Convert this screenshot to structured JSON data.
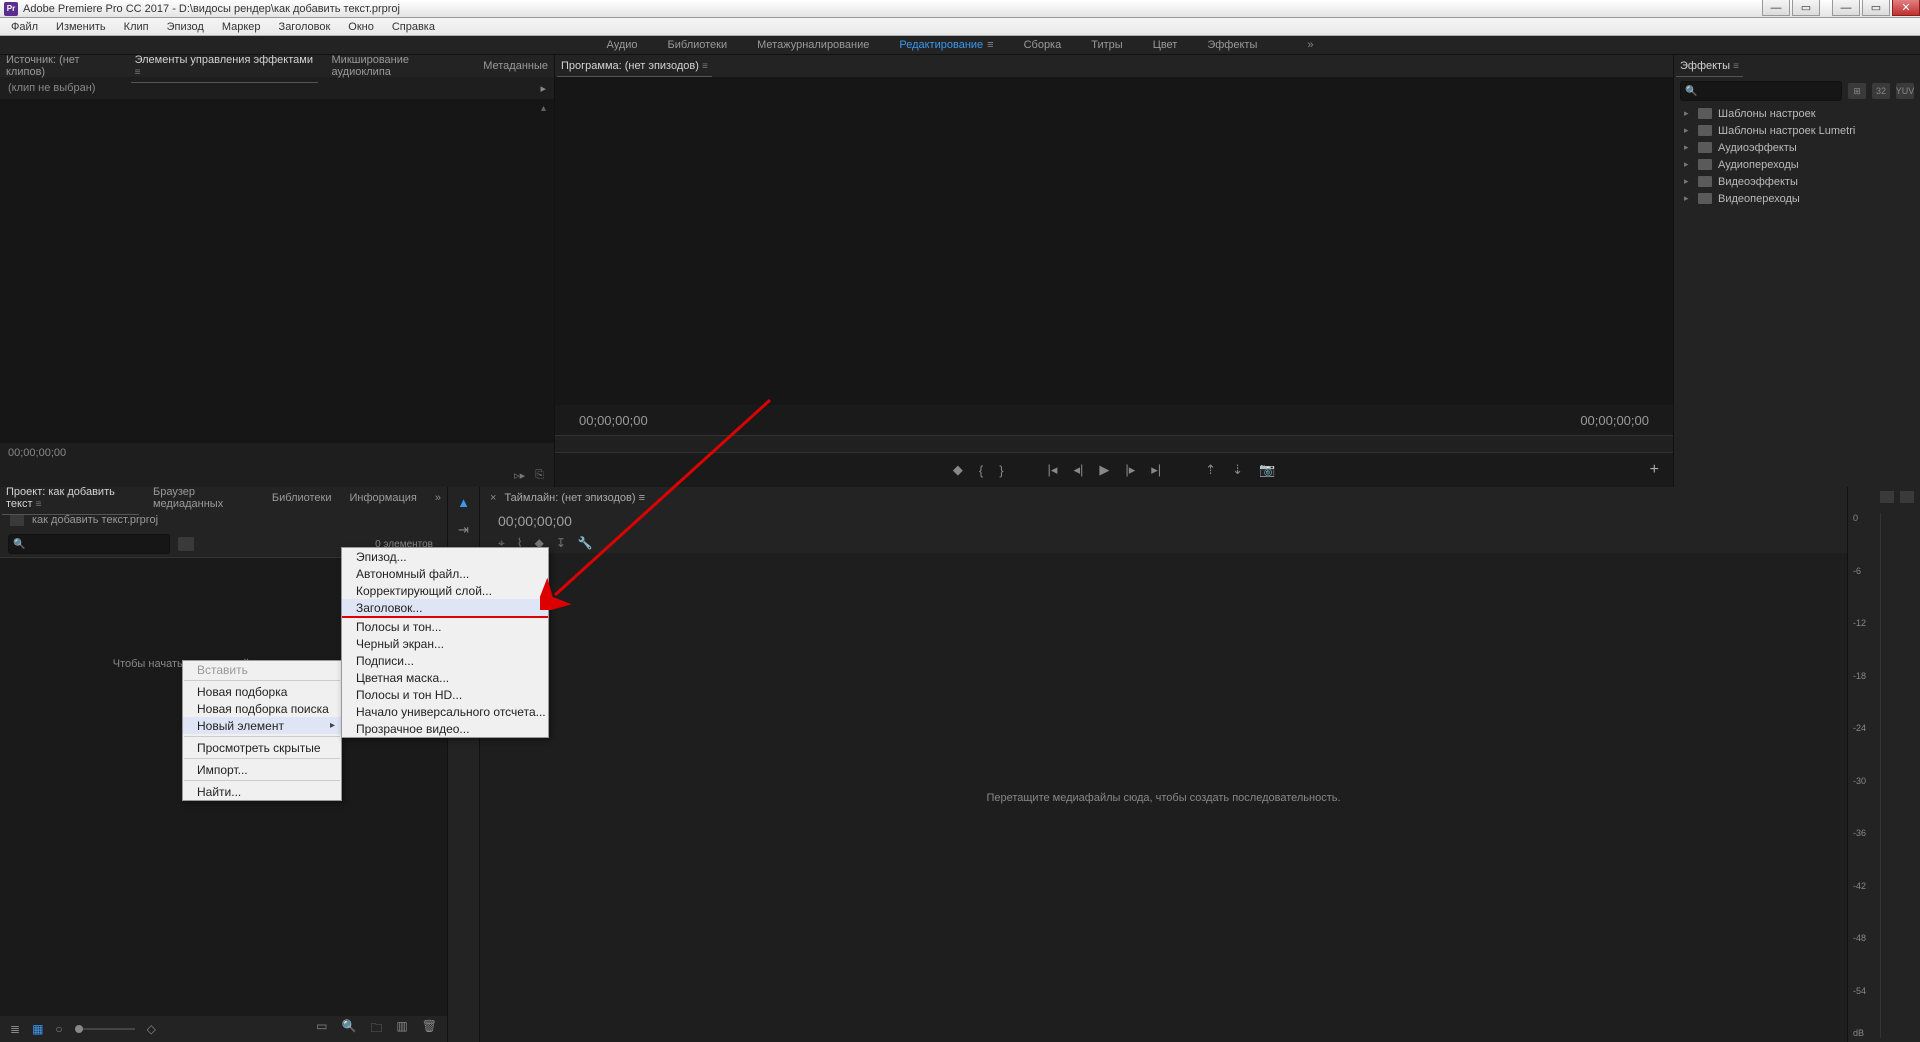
{
  "title": "Adobe Premiere Pro CC 2017 - D:\\видосы рендер\\как добавить текст.prproj",
  "app_icon": "Pr",
  "menubar": [
    "Файл",
    "Изменить",
    "Клип",
    "Эпизод",
    "Маркер",
    "Заголовок",
    "Окно",
    "Справка"
  ],
  "workspaces": {
    "items": [
      "Аудио",
      "Библиотеки",
      "Метажурналирование",
      "Редактирование",
      "Сборка",
      "Титры",
      "Цвет",
      "Эффекты"
    ],
    "active": "Редактирование"
  },
  "source_panel": {
    "tabs": [
      "Источник: (нет клипов)",
      "Элементы управления эффектами",
      "Микширование аудиоклипа",
      "Метаданные"
    ],
    "active_tab": 1,
    "sub_label": "(клип не выбран)",
    "timecode": "00;00;00;00"
  },
  "program_panel": {
    "title": "Программа: (нет эпизодов)",
    "tc_left": "00;00;00;00",
    "tc_right": "00;00;00;00"
  },
  "effects_panel": {
    "title": "Эффекты",
    "search_placeholder": "",
    "folders": [
      "Шаблоны настроек",
      "Шаблоны настроек Lumetri",
      "Аудиоэффекты",
      "Аудиопереходы",
      "Видеоэффекты",
      "Видеопереходы"
    ]
  },
  "project_panel": {
    "tabs": [
      "Проект: как добавить текст",
      "Браузер медиаданных",
      "Библиотеки",
      "Информация"
    ],
    "active_tab": 0,
    "filename": "как добавить текст.prproj",
    "item_count": "0 элементов",
    "empty_hint": "Чтобы начать, импортируйте медиаданные"
  },
  "timeline_panel": {
    "title": "Таймлайн: (нет эпизодов)",
    "timecode": "00;00;00;00",
    "empty_hint": "Перетащите медиафайлы сюда, чтобы создать последовательность."
  },
  "audio_meter_ticks": [
    "0",
    "-6",
    "-12",
    "-18",
    "-24",
    "-30",
    "-36",
    "-42",
    "-48",
    "-54",
    "dB"
  ],
  "context_menu_1": {
    "items": [
      {
        "label": "Вставить",
        "disabled": true
      },
      {
        "sep": true
      },
      {
        "label": "Новая подборка"
      },
      {
        "label": "Новая подборка поиска"
      },
      {
        "label": "Новый элемент",
        "hover": true,
        "arrow": true
      },
      {
        "sep": true
      },
      {
        "label": "Просмотреть скрытые"
      },
      {
        "sep": true
      },
      {
        "label": "Импорт..."
      },
      {
        "sep": true
      },
      {
        "label": "Найти..."
      }
    ]
  },
  "context_menu_2": {
    "items": [
      {
        "label": "Эпизод..."
      },
      {
        "label": "Автономный файл..."
      },
      {
        "label": "Корректирующий слой..."
      },
      {
        "label": "Заголовок...",
        "hover": true
      },
      {
        "redline": true
      },
      {
        "label": "Полосы и тон..."
      },
      {
        "label": "Черный экран..."
      },
      {
        "label": "Подписи..."
      },
      {
        "label": "Цветная маска..."
      },
      {
        "label": "Полосы и тон HD..."
      },
      {
        "label": "Начало универсального отсчета..."
      },
      {
        "label": "Прозрачное видео..."
      }
    ]
  }
}
